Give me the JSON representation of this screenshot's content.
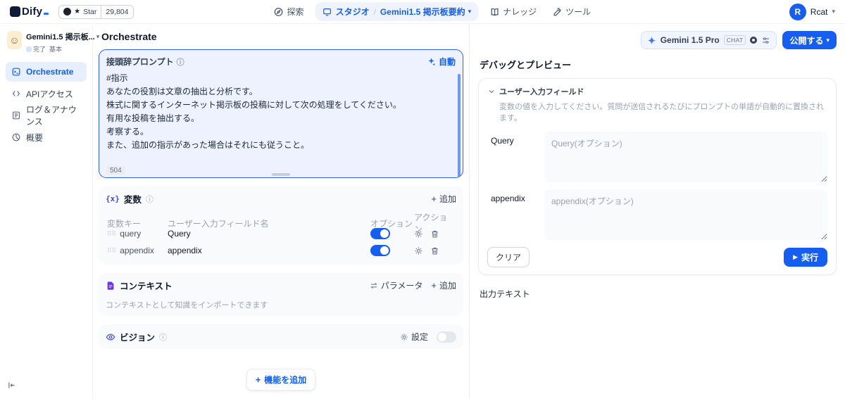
{
  "icons": {
    "star": "★",
    "caret_down": "▾",
    "chevron_small": "⌄",
    "slash": "/",
    "info": "ⓘ",
    "variable": "{x}",
    "drag": "⠿⠿",
    "plus": "+",
    "play": "▶",
    "app_face": "☺"
  },
  "colors": {
    "primary": "#155eef"
  },
  "header": {
    "logo_text": "Dify",
    "github": {
      "star_label": "Star",
      "star_count": "29,804"
    },
    "nav_explore": "探索",
    "nav_studio": "スタジオ",
    "breadcrumb_app": "Gemini1.5 掲示板要約",
    "nav_knowledge": "ナレッジ",
    "nav_tools": "ツール",
    "user_initial": "R",
    "user_name": "Rcat"
  },
  "sidebar": {
    "app_name": "Gemini1.5 掲示板...",
    "badge_done": "完了",
    "badge_basic": "基本",
    "items": [
      {
        "label": "Orchestrate"
      },
      {
        "label": "APIアクセス"
      },
      {
        "label": "ログ＆アナウンス"
      },
      {
        "label": "概要"
      }
    ]
  },
  "main": {
    "title": "Orchestrate",
    "model": {
      "name": "Gemini 1.5 Pro",
      "mode_badge": "CHAT"
    },
    "publish_label": "公開する",
    "prompt": {
      "title": "接頭辞プロンプト",
      "auto_label": "自動",
      "char_count": "504",
      "text": "#指示\nあなたの役割は文章の抽出と分析です。\n株式に関するインターネット掲示板の投稿に対して次の処理をしてください。\n有用な投稿を抽出する。\n考察する。\nまた、追加の指示があった場合はそれにも従うこと。\n\n\n#抽出方法\n日付と内容を\"日付:内容\"形式で抽出。\n抽出した投稿は日付順にまとめること。"
    },
    "variables": {
      "title": "変数",
      "add_label": "追加",
      "columns": [
        "変数キー",
        "ユーザー入力フィールド名",
        "オプション",
        "アクション"
      ],
      "rows": [
        {
          "key": "query",
          "field": "Query"
        },
        {
          "key": "appendix",
          "field": "appendix"
        }
      ]
    },
    "context": {
      "title": "コンテキスト",
      "params_label": "パラメータ",
      "add_label": "追加",
      "description": "コンテキストとして知識をインポートできます"
    },
    "vision": {
      "title": "ビジョン",
      "settings_label": "設定"
    },
    "add_feature_label": "機能を追加"
  },
  "debug": {
    "title": "デバッグとプレビュー",
    "input_section_title": "ユーザー入力フィールド",
    "description": "変数の値を入力してください。質問が送信されるたびにプロンプトの単語が自動的に置換されます。",
    "fields": [
      {
        "label": "Query",
        "placeholder": "Query(オプション)"
      },
      {
        "label": "appendix",
        "placeholder": "appendix(オプション)"
      }
    ],
    "clear_label": "クリア",
    "run_label": "実行",
    "output_label": "出力テキスト"
  }
}
